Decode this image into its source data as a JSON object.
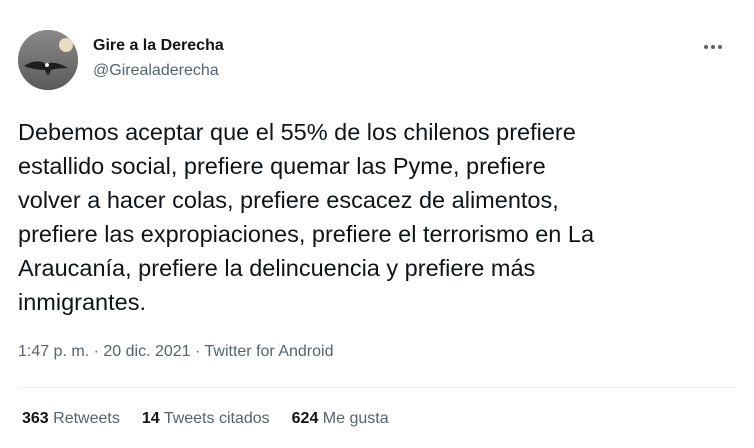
{
  "author": {
    "name": "Gire a la Derecha",
    "handle": "@Girealaderecha",
    "avatar_icon": "condor-moon-avatar"
  },
  "more_icon": "more-options-icon",
  "tweet": {
    "text": "Debemos aceptar que el 55% de los chilenos prefiere\nestallido social, prefiere quemar las Pyme, prefiere\nvolver a hacer colas, prefiere escacez de alimentos,\nprefiere las expropiaciones, prefiere el terrorismo en La\nAraucanía, prefiere la delincuencia y prefiere más\ninmigrantes."
  },
  "meta": {
    "time": "1:47 p. m.",
    "date": "20 dic. 2021",
    "source": "Twitter for Android",
    "separator": "·"
  },
  "stats": {
    "retweets_count": "363",
    "retweets_label": "Retweets",
    "quotes_count": "14",
    "quotes_label": "Tweets citados",
    "likes_count": "624",
    "likes_label": "Me gusta"
  },
  "colors": {
    "primary_text": "#0f1419",
    "secondary_text": "#536471",
    "divider": "#eff3f4"
  }
}
